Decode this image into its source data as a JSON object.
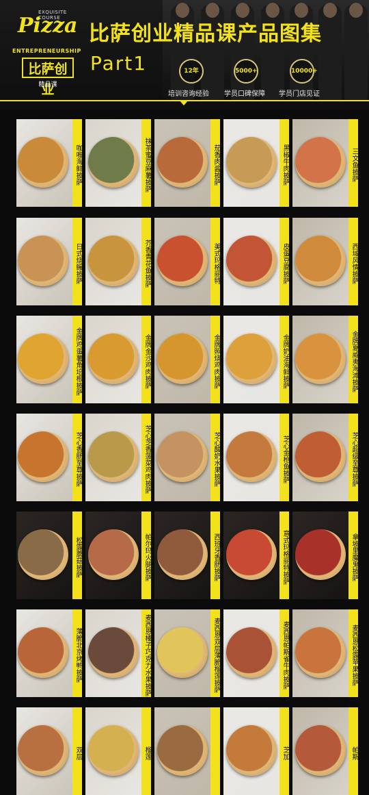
{
  "header": {
    "logo": {
      "small": "EXQUISITE COURSE",
      "pizza": "Pizza",
      "entrepreneurship": "ENTREPRENEURSHIP",
      "box": "比萨创业",
      "sub": "精品课"
    },
    "title": "比萨创业精品课产品图集",
    "part": "Part1",
    "stats": [
      {
        "badge": "12年",
        "label": "培训咨询经验"
      },
      {
        "badge": "5000+",
        "label": "学员口碑保障"
      },
      {
        "badge": "10000+",
        "label": "学员门店见证"
      }
    ]
  },
  "products": [
    {
      "name": "咖喱海鲜披萨",
      "color": "#c98a3a"
    },
    {
      "name": "抹茶蜜豆麻薯披萨",
      "color": "#6f7c4a"
    },
    {
      "name": "茄香肉酱披萨",
      "color": "#b86a3a"
    },
    {
      "name": "黑椒牛肉披萨",
      "color": "#c79a55"
    },
    {
      "name": "三文鱼披萨",
      "color": "#d2734a"
    },
    {
      "name": "日式烧鳗披萨",
      "color": "#c99355"
    },
    {
      "name": "芥香青花鱼披萨",
      "color": "#c8943e"
    },
    {
      "name": "美式玛格丽特",
      "color": "#c9512f"
    },
    {
      "name": "皮蛋豆腐披萨",
      "color": "#c25536"
    },
    {
      "name": "西域风情披萨",
      "color": "#d08a3b"
    },
    {
      "name": "金牌鸡蛋薯角培根披萨",
      "color": "#e0a431"
    },
    {
      "name": "金牌金沙鸡肉披萨",
      "color": "#d99a2f"
    },
    {
      "name": "金牌照烧鸡肉披萨",
      "color": "#d6962e"
    },
    {
      "name": "金牌奶油海鲜披萨",
      "color": "#dda03a"
    },
    {
      "name": "金牌夏威夷海滩披萨",
      "color": "#d9923d"
    },
    {
      "name": "芝心香肠至尊披萨",
      "color": "#c7742f"
    },
    {
      "name": "芝心芝香菠菜鸡肉披萨",
      "color": "#b99a4a"
    },
    {
      "name": "芝心酸奶水果披萨",
      "color": "#c59262"
    },
    {
      "name": "芝心金枪鱼披萨",
      "color": "#c37a3c"
    },
    {
      "name": "芝心超级至尊披萨",
      "color": "#bf5d35"
    },
    {
      "name": "松露蘑菇披萨",
      "color": "#8a6b48"
    },
    {
      "name": "帕尔玛火腿披萨",
      "color": "#b66a48"
    },
    {
      "name": "西班牙香肠披萨",
      "color": "#8f5b3c"
    },
    {
      "name": "意式玛格丽特披萨",
      "color": "#c84a32"
    },
    {
      "name": "拿坡里魔鬼披萨",
      "color": "#a8322a"
    },
    {
      "name": "薄脆北京烤鸭披萨",
      "color": "#b8653a"
    },
    {
      "name": "麦西恩榛子巧克力水果披萨",
      "color": "#6a4a3a"
    },
    {
      "name": "麦西恩双层薄脆榴莲披萨",
      "color": "#e1c55a"
    },
    {
      "name": "麦西恩帕斯雀牛肉披萨",
      "color": "#a95236"
    },
    {
      "name": "麦西恩松露苹果披萨",
      "color": "#c9733d"
    },
    {
      "name": "双层",
      "color": "#b87040"
    },
    {
      "name": "榴莲",
      "color": "#d4b050"
    },
    {
      "name": "",
      "color": "#9a6a40"
    },
    {
      "name": "芝加",
      "color": "#c47a3a"
    },
    {
      "name": "帕斯",
      "color": "#b45a3a"
    }
  ]
}
